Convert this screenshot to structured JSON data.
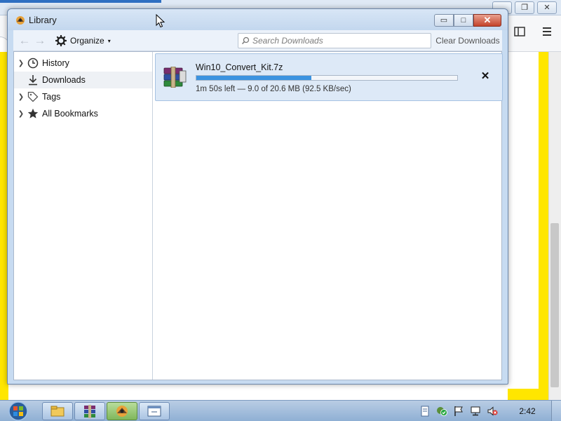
{
  "window": {
    "title": "Library",
    "controls": {
      "minimize": "▭",
      "maximize": "□",
      "close": "✕"
    }
  },
  "toolbar": {
    "organize_label": "Organize",
    "search_placeholder": "Search Downloads",
    "clear_label": "Clear Downloads"
  },
  "sidebar": {
    "items": [
      {
        "label": "History",
        "icon": "clock-icon",
        "expandable": true,
        "selected": false
      },
      {
        "label": "Downloads",
        "icon": "download-arrow-icon",
        "expandable": false,
        "selected": true
      },
      {
        "label": "Tags",
        "icon": "tag-icon",
        "expandable": true,
        "selected": false
      },
      {
        "label": "All Bookmarks",
        "icon": "star-icon",
        "expandable": true,
        "selected": false
      }
    ]
  },
  "downloads": [
    {
      "filename": "Win10_Convert_Kit.7z",
      "status": "1m 50s left — 9.0 of 20.6 MB (92.5 KB/sec)",
      "progress": 0.44,
      "icon": "winrar-archive-icon"
    }
  ],
  "taskbar": {
    "clock": "2:42",
    "items": [
      "windows-explorer-icon",
      "winrar-icon",
      "firefox-library-icon",
      "window-icon"
    ]
  },
  "colors": {
    "accent": "#3c93e0",
    "background_highlight": "#ffe600",
    "selected_row": "#dde9f7"
  }
}
